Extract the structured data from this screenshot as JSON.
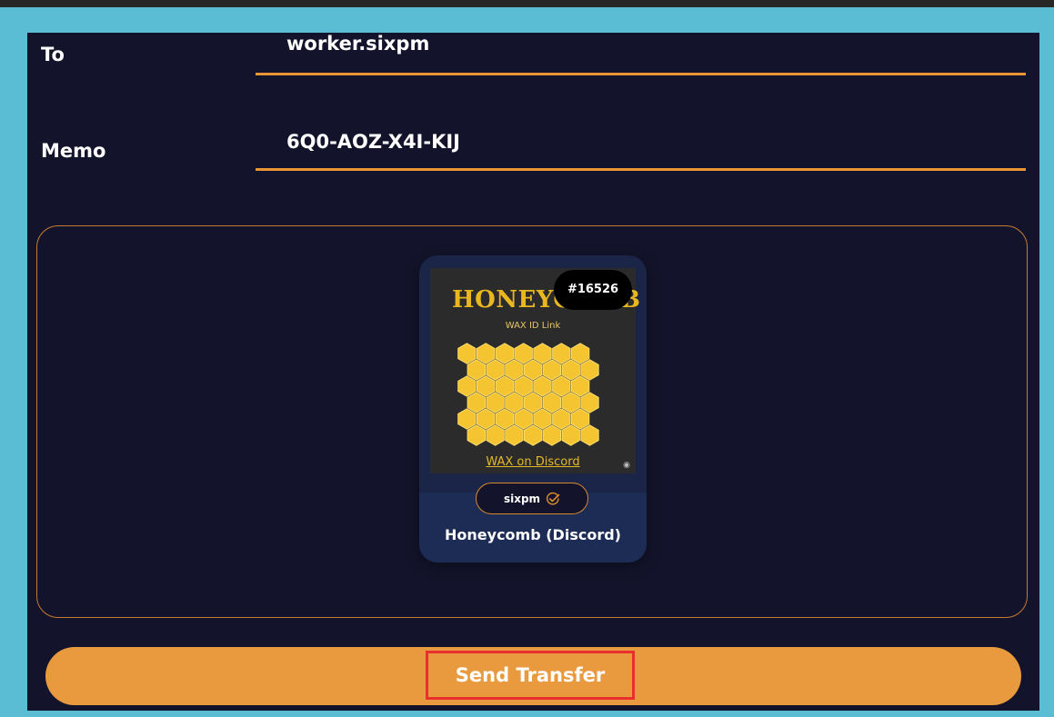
{
  "form": {
    "to_label": "To",
    "to_value": "worker.sixpm",
    "memo_label": "Memo",
    "memo_value": "6Q0-AOZ-X4I-KIJ"
  },
  "nft_card": {
    "image_title": "HONEYCOMB",
    "image_subtitle": "WAX ID Link",
    "image_link": "WAX on Discord",
    "asset_number": "#16526",
    "owner": "sixpm",
    "owner_icon": "verified-check-icon",
    "name": "Honeycomb (Discord)"
  },
  "actions": {
    "send_label": "Send Transfer"
  },
  "colors": {
    "background_panel": "#13142b",
    "frame": "#5bbdd4",
    "accent": "#e99a3f",
    "highlight_box": "#e9302e",
    "card": "#1a2547",
    "honey": "#f5c431"
  }
}
